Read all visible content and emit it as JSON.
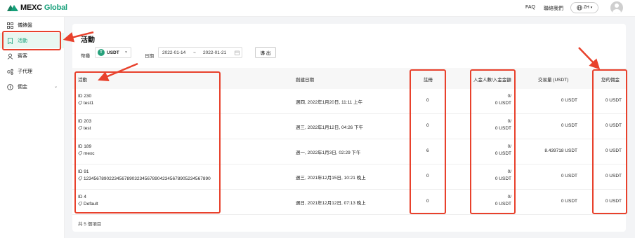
{
  "header": {
    "brand": "MEXC",
    "brand_suffix": "Global",
    "faq": "FAQ",
    "contact": "聯絡我們",
    "language": "ZH"
  },
  "sidebar": {
    "items": [
      {
        "label": "儀錶盤",
        "icon": "dashboard-icon"
      },
      {
        "label": "活動",
        "icon": "bookmark-icon"
      },
      {
        "label": "賓客",
        "icon": "guest-icon"
      },
      {
        "label": "子代理",
        "icon": "sub-agent-icon"
      },
      {
        "label": "佣金",
        "icon": "commission-icon"
      }
    ]
  },
  "page": {
    "title": "活動",
    "currency_label": "幣種",
    "currency_value": "USDT",
    "date_label": "日期",
    "date_start": "2022-01-14",
    "date_sep": "~",
    "date_end": "2022-01-21",
    "export_label": "導 出"
  },
  "table": {
    "columns": [
      "活動",
      "創建日期",
      "註冊",
      "入金人數/入金金額",
      "交易量 (USDT)",
      "您的佣金"
    ],
    "rows": [
      {
        "id": "ID 230",
        "name": "test1",
        "created": "週四, 2022年1月20日, 11:11 上午",
        "registrations": "0",
        "deposit_count": "0/",
        "deposit_amount": "0 USDT",
        "volume": "0 USDT",
        "commission": "0 USDT"
      },
      {
        "id": "ID 203",
        "name": "test",
        "created": "週三, 2022年1月12日, 04:26 下午",
        "registrations": "0",
        "deposit_count": "0/",
        "deposit_amount": "0 USDT",
        "volume": "0 USDT",
        "commission": "0 USDT"
      },
      {
        "id": "ID 189",
        "name": "mexc",
        "created": "週一, 2022年1月3日, 02:29 下午",
        "registrations": "6",
        "deposit_count": "0/",
        "deposit_amount": "0 USDT",
        "volume": "8.439718 USDT",
        "commission": "0 USDT"
      },
      {
        "id": "ID 91",
        "name": "1234567890223456789032345678904234567890523456789​0",
        "created": "週三, 2021年12月15日, 10:21 晚上",
        "registrations": "0",
        "deposit_count": "0/",
        "deposit_amount": "0 USDT",
        "volume": "0 USDT",
        "commission": "0 USDT"
      },
      {
        "id": "ID 4",
        "name": "Default",
        "created": "週日, 2021年12月12日, 07:13 晚上",
        "registrations": "0",
        "deposit_count": "0/",
        "deposit_amount": "0 USDT",
        "volume": "0 USDT",
        "commission": "0 USDT"
      }
    ],
    "total": "共 5 個項目"
  },
  "colors": {
    "accent": "#16a07a",
    "annotation": "#e8412c"
  }
}
